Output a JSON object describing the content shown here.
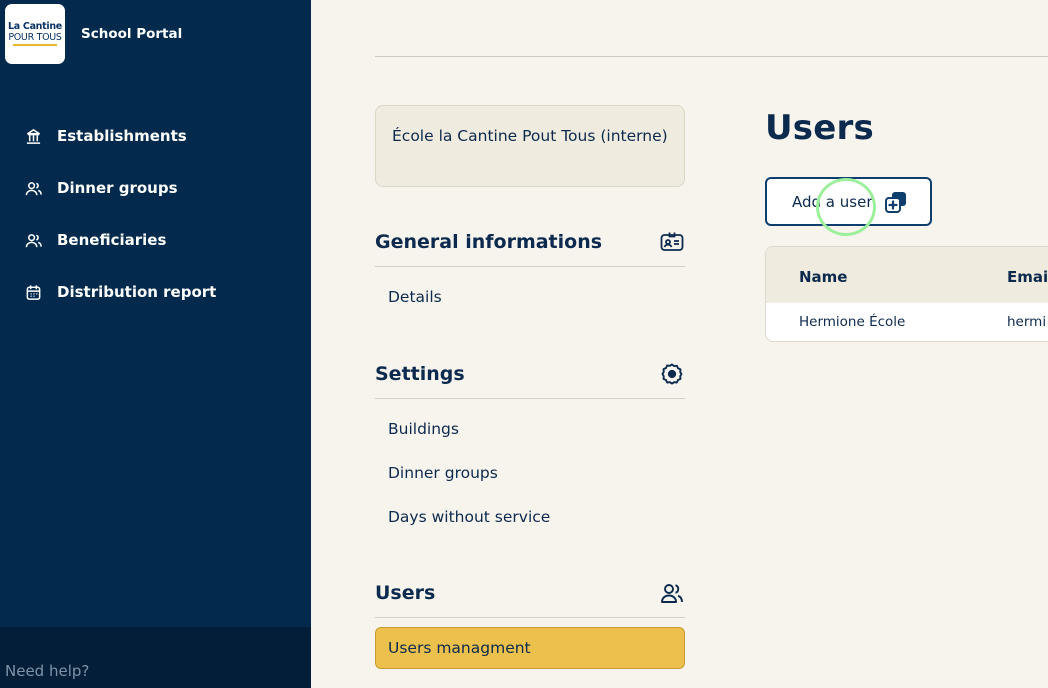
{
  "app": {
    "logo_line1": "La Cantine",
    "logo_line2": "POUR TOUS",
    "title": "School Portal"
  },
  "sidebar": {
    "items": [
      {
        "label": "Establishments",
        "icon": "building-icon"
      },
      {
        "label": "Dinner groups",
        "icon": "group-icon"
      },
      {
        "label": "Beneficiaries",
        "icon": "group-icon"
      },
      {
        "label": "Distribution report",
        "icon": "calendar-icon"
      }
    ],
    "help": "Need help?"
  },
  "school": {
    "name": "École la Cantine Pout Tous (interne)"
  },
  "sections": {
    "general": {
      "title": "General informations",
      "icon": "id-card-icon",
      "items": [
        "Details"
      ]
    },
    "settings": {
      "title": "Settings",
      "icon": "gear-icon",
      "items": [
        "Buildings",
        "Dinner groups",
        "Days without service"
      ]
    },
    "users": {
      "title": "Users",
      "icon": "users-icon",
      "items": [
        "Users managment"
      ]
    }
  },
  "main": {
    "title": "Users",
    "add_button": "Add a user",
    "table": {
      "columns": [
        "Name",
        "Email"
      ],
      "rows": [
        {
          "name": "Hermione École",
          "email": "hermi"
        }
      ]
    }
  },
  "colors": {
    "sidebar_bg": "#032a4d",
    "page_bg": "#f7f4ee",
    "accent_yellow": "#ecc04c",
    "text_navy": "#0c2a4d"
  }
}
